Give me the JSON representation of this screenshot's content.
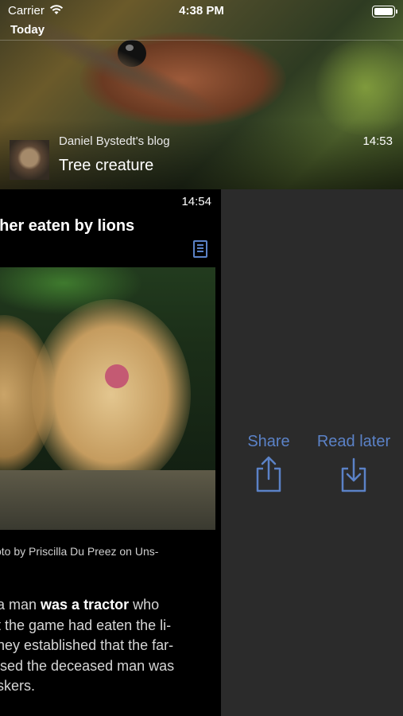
{
  "status_bar": {
    "carrier": "Carrier",
    "time": "4:38 PM"
  },
  "section_title": "Today",
  "feed_item": {
    "source": "Daniel Bystedt's blog",
    "title": "Tree creature",
    "time": "14:53"
  },
  "article": {
    "time": "14:54",
    "title": "cher eaten by lions",
    "caption": "oto by Priscilla Du Preez on Uns-",
    "paragraph": {
      "l1_a": "a man ",
      "l1_b": "was a tractor",
      "l1_c": " who",
      "l2": "t the game had eaten the li-",
      "l3": "hey established that the far-",
      "l4": "ised the deceased man was",
      "l5": "skers."
    }
  },
  "actions": {
    "share": "Share",
    "read_later": "Read later"
  },
  "colors": {
    "accent": "#5b82c7",
    "panel": "#2b2b2b"
  }
}
